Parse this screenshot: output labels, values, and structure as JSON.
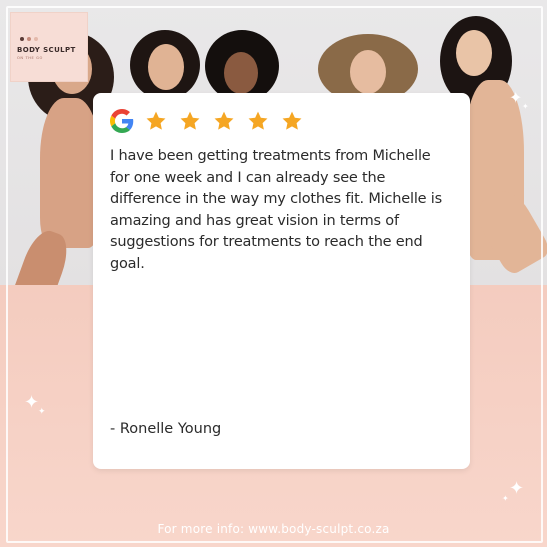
{
  "brand": {
    "name": "BODY SCULPT",
    "tagline": "ON THE GO",
    "dot_colors": [
      "#5a3b36",
      "#c58a7a",
      "#e4b9ab"
    ]
  },
  "review": {
    "stars": 5,
    "star_color": "#f5a623",
    "source_icon": "google-icon",
    "text": "I have been getting treatments from Michelle for one week and I can already see the difference in the way my clothes fit. Michelle is amazing and has great vision in terms of suggestions for treatments to reach the end goal.",
    "author": "- Ronelle Young"
  },
  "footer": {
    "info": "For more info: www.body-sculpt.co.za"
  },
  "colors": {
    "background_pink": "#f6d0c4",
    "card": "#ffffff",
    "text": "#2b2b2b"
  }
}
